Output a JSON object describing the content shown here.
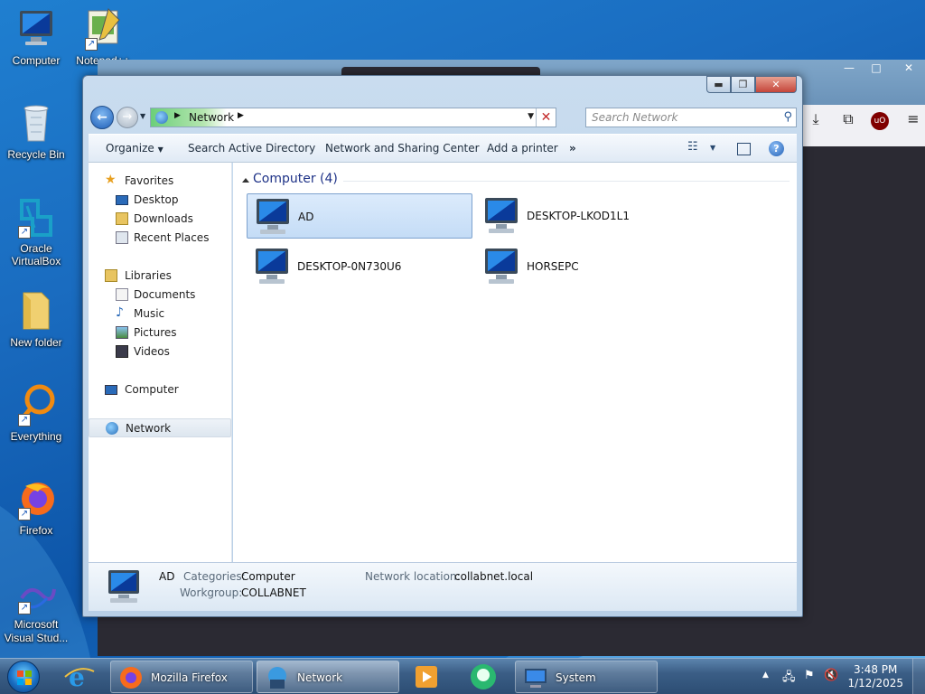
{
  "desktop": {
    "icons": [
      {
        "label": "Computer"
      },
      {
        "label": "Notepad++"
      },
      {
        "label": "Recycle Bin"
      },
      {
        "label": "Oracle VirtualBox"
      },
      {
        "label": "New folder"
      },
      {
        "label": "Everything"
      },
      {
        "label": "Firefox"
      },
      {
        "label": "Microsoft Visual Stud..."
      }
    ]
  },
  "explorer": {
    "address": {
      "crumb": "Network"
    },
    "search": {
      "placeholder": "Search Network"
    },
    "commands": {
      "organize": "Organize",
      "search_ad": "Search Active Directory",
      "network_sharing": "Network and Sharing Center",
      "add_printer": "Add a printer",
      "more": "»"
    },
    "nav": {
      "favorites": "Favorites",
      "desktop": "Desktop",
      "downloads": "Downloads",
      "recent_places": "Recent Places",
      "libraries": "Libraries",
      "documents": "Documents",
      "music": "Music",
      "pictures": "Pictures",
      "videos": "Videos",
      "computer": "Computer",
      "network": "Network"
    },
    "group": {
      "title": "Computer (4)"
    },
    "items": [
      {
        "label": "AD"
      },
      {
        "label": "DESKTOP-LKOD1L1"
      },
      {
        "label": "DESKTOP-0N730U6"
      },
      {
        "label": "HORSEPC"
      }
    ],
    "details": {
      "name": "AD",
      "categories_label": "Categories:",
      "categories_value": "Computer",
      "workgroup_label": "Workgroup:",
      "workgroup_value": "COLLABNET",
      "location_label": "Network location:",
      "location_value": "collabnet.local"
    }
  },
  "taskbar": {
    "firefox": "Mozilla Firefox",
    "network": "Network",
    "system": "System",
    "time": "3:48 PM",
    "date": "1/12/2025"
  },
  "colors": {
    "accent": "#1e3287",
    "selection": "#c4dcf6",
    "taskbar": "#3b5e86"
  }
}
